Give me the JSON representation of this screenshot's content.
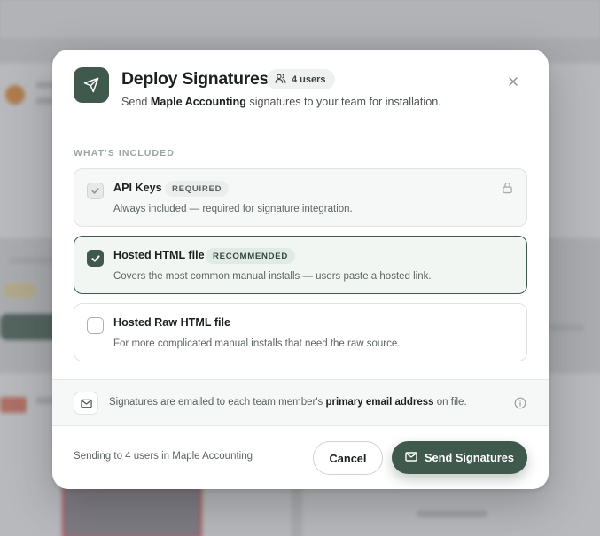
{
  "modal": {
    "title": "Deploy Signatures",
    "users_badge": "4 users",
    "subtitle_prefix": "Send ",
    "subtitle_company": "Maple Accounting",
    "subtitle_suffix": " signatures to your team for installation."
  },
  "section_label": "WHAT'S INCLUDED",
  "options": [
    {
      "title": "API Keys",
      "tag": "REQUIRED",
      "description": "Always included — required for signature integration.",
      "state": "locked-checked"
    },
    {
      "title": "Hosted HTML file",
      "tag": "RECOMMENDED",
      "description": "Covers the most common manual installs — users paste a hosted link.",
      "state": "checked"
    },
    {
      "title": "Hosted Raw HTML file",
      "tag": "",
      "description": "For more complicated manual installs that need the raw source.",
      "state": "unchecked"
    }
  ],
  "info": {
    "prefix": "Signatures are emailed to each team member's ",
    "emphasis": "primary email address",
    "suffix": " on file."
  },
  "footer": {
    "status": "Sending to 4 users in Maple Accounting",
    "cancel_label": "Cancel",
    "send_label": "Send Signatures"
  },
  "colors": {
    "primary": "#3f5a4d",
    "selected_bg": "#f1f6f3"
  },
  "icons": {
    "header": "send-icon",
    "users": "users-icon",
    "close": "close-icon",
    "lock": "lock-icon",
    "mail": "mail-icon",
    "info": "info-icon"
  }
}
